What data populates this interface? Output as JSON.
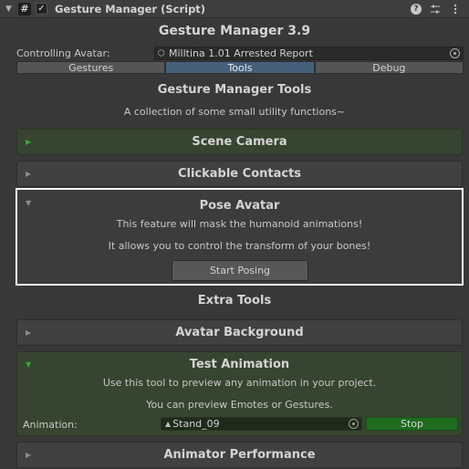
{
  "header": {
    "fold_glyph": "▼",
    "script_icon_glyph": "#",
    "enabled_glyph": "✓",
    "title": "Gesture Manager (Script)",
    "icons": [
      "help-icon",
      "sliders-icon",
      "kebab-menu-icon"
    ]
  },
  "main_title": "Gesture Manager 3.9",
  "controlling": {
    "label": "Controlling Avatar:",
    "value": "Milltina 1.01 Arrested Report"
  },
  "tabs": [
    {
      "label": "Gestures",
      "active": false
    },
    {
      "label": "Tools",
      "active": true
    },
    {
      "label": "Debug",
      "active": false
    }
  ],
  "tools": {
    "title": "Gesture Manager Tools",
    "subtitle": "A collection of some small utility functions~"
  },
  "foldouts": {
    "scene_camera": {
      "title": "Scene Camera",
      "expanded": false,
      "active": true
    },
    "clickable_contacts": {
      "title": "Clickable Contacts",
      "expanded": false
    },
    "pose_avatar": {
      "title": "Pose Avatar",
      "expanded": true,
      "line1": "This feature will mask the humanoid animations!",
      "line2": "It allows you to control the transform of your bones!",
      "button": "Start Posing"
    },
    "avatar_background": {
      "title": "Avatar Background",
      "expanded": false
    },
    "test_animation": {
      "title": "Test Animation",
      "expanded": true,
      "line1": "Use this tool to preview any animation in your project.",
      "line2": "You can preview Emotes or Gestures.",
      "anim_label": "Animation:",
      "anim_value": "Stand_09",
      "stop_label": "Stop"
    },
    "animator_performance": {
      "title": "Animator Performance",
      "expanded": false
    }
  },
  "extra_tools_title": "Extra Tools",
  "colors": {
    "background": "#383838",
    "active_tab": "#46607c",
    "active_green": "#36452f",
    "stop_button": "#1f6b1f",
    "selection_outline": "#ffffff"
  }
}
